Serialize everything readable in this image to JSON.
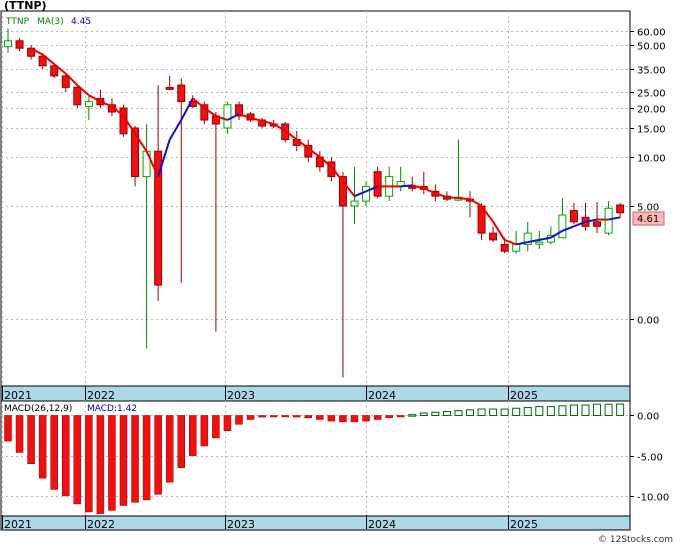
{
  "chart_title": "(TTNP)",
  "legend": {
    "symbol": "TTNP",
    "ma_label": "MA(3)",
    "ma_value": "4.45"
  },
  "price_badge": "4.61",
  "macd_legend": {
    "label": "MACD(26,12,9)",
    "value_label": "MACD:1.42"
  },
  "watermark": "© 12Stocks.com",
  "colors": {
    "up": "#00aa00",
    "down": "#ee1111",
    "ma_down": "#ee0000",
    "ma_up": "#1111cc",
    "axis_band": "#add8e6",
    "grid": "#bbbbbb",
    "badge_bg": "#ffb6b6"
  },
  "chart_data": [
    {
      "type": "candlestick",
      "title": "(TTNP)",
      "y_scale": "log-like",
      "y_ticks": [
        "60.00",
        "50.00",
        "35.00",
        "25.00",
        "20.00",
        "15.00",
        "10.00",
        "5.00",
        "0.00"
      ],
      "x_year_labels": [
        "2021",
        "2022",
        "2023",
        "2024",
        "2025"
      ],
      "grid": true,
      "series": [
        {
          "name": "TTNP",
          "candles": [
            {
              "o": 49,
              "h": 62,
              "l": 45,
              "c": 53
            },
            {
              "o": 53,
              "h": 55,
              "l": 46,
              "c": 48
            },
            {
              "o": 48,
              "h": 50,
              "l": 41,
              "c": 43
            },
            {
              "o": 43,
              "h": 45,
              "l": 35,
              "c": 37
            },
            {
              "o": 37,
              "h": 38,
              "l": 31,
              "c": 32
            },
            {
              "o": 32,
              "h": 33,
              "l": 25,
              "c": 27
            },
            {
              "o": 27,
              "h": 28,
              "l": 20,
              "c": 21
            },
            {
              "o": 20.5,
              "h": 24,
              "l": 17,
              "c": 22
            },
            {
              "o": 23,
              "h": 26,
              "l": 20,
              "c": 21
            },
            {
              "o": 21,
              "h": 23,
              "l": 18,
              "c": 19
            },
            {
              "o": 20,
              "h": 21,
              "l": 13.5,
              "c": 14
            },
            {
              "o": 15,
              "h": 15.5,
              "l": 7,
              "c": 8
            },
            {
              "o": 8,
              "h": 16,
              "l": -3.5,
              "c": 11
            },
            {
              "o": 11,
              "h": 28,
              "l": 0.8,
              "c": 1.5
            },
            {
              "o": 27,
              "h": 32,
              "l": 26,
              "c": 26.5
            },
            {
              "o": 28,
              "h": 31,
              "l": 1.6,
              "c": 22
            },
            {
              "o": 22,
              "h": 24,
              "l": 20,
              "c": 20.5
            },
            {
              "o": 21,
              "h": 22,
              "l": 16,
              "c": 17
            },
            {
              "o": 18,
              "h": 19,
              "l": -1.5,
              "c": 16
            },
            {
              "o": 15,
              "h": 22,
              "l": 14,
              "c": 21
            },
            {
              "o": 21,
              "h": 22,
              "l": 17,
              "c": 18
            },
            {
              "o": 18.5,
              "h": 19,
              "l": 16.5,
              "c": 17
            },
            {
              "o": 17,
              "h": 17.5,
              "l": 15,
              "c": 15.5
            },
            {
              "o": 16,
              "h": 17,
              "l": 15,
              "c": 15.5
            },
            {
              "o": 16,
              "h": 16.5,
              "l": 12.5,
              "c": 13
            },
            {
              "o": 13,
              "h": 14.5,
              "l": 11,
              "c": 12
            },
            {
              "o": 12,
              "h": 13,
              "l": 9.5,
              "c": 10
            },
            {
              "o": 10,
              "h": 11,
              "l": 8.5,
              "c": 9
            },
            {
              "o": 9.5,
              "h": 10,
              "l": 7.5,
              "c": 8
            },
            {
              "o": 8,
              "h": 8.5,
              "l": -7,
              "c": 5
            },
            {
              "o": 5,
              "h": 9,
              "l": 4.2,
              "c": 5.5
            },
            {
              "o": 5.5,
              "h": 7.5,
              "l": 5,
              "c": 7
            },
            {
              "o": 8.5,
              "h": 9,
              "l": 5.8,
              "c": 6
            },
            {
              "o": 6,
              "h": 9,
              "l": 5.5,
              "c": 8
            },
            {
              "o": 7,
              "h": 9,
              "l": 6.5,
              "c": 7.5
            },
            {
              "o": 7,
              "h": 8,
              "l": 6.5,
              "c": 6.8
            },
            {
              "o": 7,
              "h": 8.5,
              "l": 6.2,
              "c": 6.7
            },
            {
              "o": 6.5,
              "h": 7.2,
              "l": 5.5,
              "c": 6
            },
            {
              "o": 6,
              "h": 6.5,
              "l": 5.5,
              "c": 5.7
            },
            {
              "o": 5.6,
              "h": 13,
              "l": 5.5,
              "c": 5.9
            },
            {
              "o": 5.7,
              "h": 6.5,
              "l": 4.5,
              "c": 5.5
            },
            {
              "o": 5,
              "h": 5.3,
              "l": 3.5,
              "c": 3.8
            },
            {
              "o": 3.8,
              "h": 4.1,
              "l": 3.4,
              "c": 3.5
            },
            {
              "o": 3.3,
              "h": 3.6,
              "l": 2.9,
              "c": 3
            },
            {
              "o": 3,
              "h": 3.9,
              "l": 2.9,
              "c": 3.3
            },
            {
              "o": 3.3,
              "h": 4.3,
              "l": 3,
              "c": 3.8
            },
            {
              "o": 3.4,
              "h": 3.9,
              "l": 3.1,
              "c": 3.4
            },
            {
              "o": 3.4,
              "h": 4.1,
              "l": 3.3,
              "c": 3.7
            },
            {
              "o": 3.6,
              "h": 5.8,
              "l": 3.6,
              "c": 4.6
            },
            {
              "o": 4.8,
              "h": 5.3,
              "l": 4.2,
              "c": 4.3
            },
            {
              "o": 4.5,
              "h": 5.3,
              "l": 3.9,
              "c": 4.1
            },
            {
              "o": 4.3,
              "h": 5.4,
              "l": 3.8,
              "c": 4.1
            },
            {
              "o": 3.8,
              "h": 5.5,
              "l": 3.7,
              "c": 4.9
            },
            {
              "o": 5.1,
              "h": 5.3,
              "l": 4.5,
              "c": 4.7
            }
          ]
        },
        {
          "name": "MA(3)",
          "values": [
            null,
            null,
            48,
            44,
            38,
            33,
            28,
            24,
            22,
            20.5,
            18,
            14,
            11,
            8,
            13,
            17,
            23,
            20,
            18,
            17,
            18.5,
            17.5,
            16.8,
            16,
            14.5,
            13,
            11.5,
            10,
            9,
            7.5,
            6,
            6.5,
            7,
            7,
            7,
            7.1,
            6.8,
            6.3,
            5.9,
            5.8,
            5.7,
            5,
            4.3,
            3.5,
            3.3,
            3.4,
            3.5,
            3.6,
            3.9,
            4.1,
            4.3,
            4.4,
            4.4,
            4.5
          ]
        }
      ]
    },
    {
      "type": "bar",
      "title": "MACD(26,12,9)",
      "y_ticks": [
        "0.00",
        "-5.00",
        "-10.00"
      ],
      "ylim": [
        -12.5,
        1.8
      ],
      "values": [
        -3.2,
        -4.6,
        -6.0,
        -7.8,
        -9.2,
        -10.0,
        -11.0,
        -12.0,
        -12.2,
        -11.8,
        -11.2,
        -10.8,
        -10.5,
        -9.8,
        -8.3,
        -6.5,
        -5.0,
        -3.8,
        -2.8,
        -1.9,
        -1.1,
        -0.5,
        -0.2,
        -0.1,
        -0.1,
        -0.2,
        -0.3,
        -0.5,
        -0.7,
        -0.8,
        -0.8,
        -0.7,
        -0.5,
        -0.3,
        -0.1,
        0.1,
        0.3,
        0.4,
        0.5,
        0.6,
        0.7,
        0.8,
        0.8,
        0.8,
        0.9,
        1.0,
        1.1,
        1.1,
        1.2,
        1.3,
        1.3,
        1.4,
        1.4,
        1.42
      ]
    }
  ]
}
